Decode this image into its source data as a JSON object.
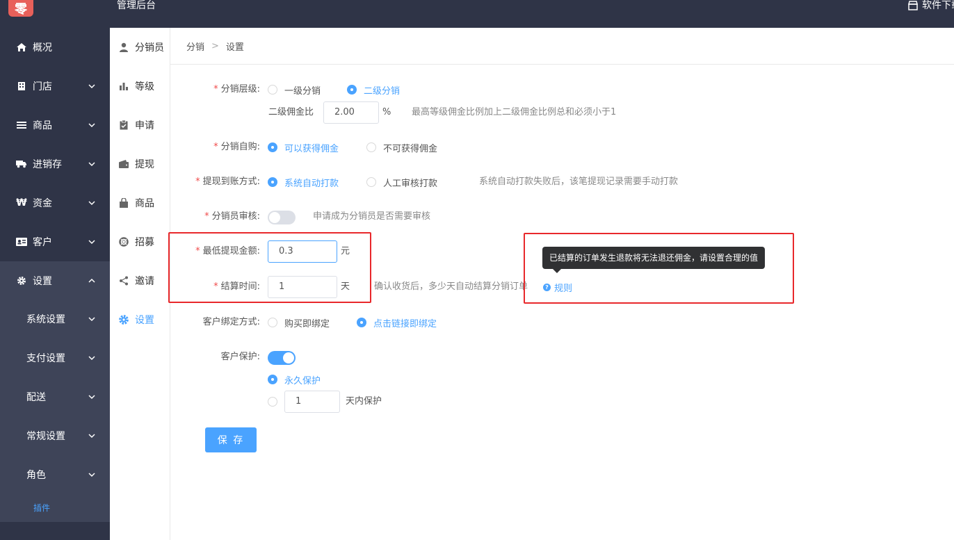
{
  "topbar": {
    "logo_char": "零",
    "title": "管理后台",
    "right_link": "软件下载"
  },
  "sidebar": {
    "items": [
      {
        "label": "概况",
        "icon": "home-icon"
      },
      {
        "label": "门店",
        "icon": "building-icon"
      },
      {
        "label": "商品",
        "icon": "list-icon"
      },
      {
        "label": "进销存",
        "icon": "truck-icon"
      },
      {
        "label": "资金",
        "icon": "won-icon"
      },
      {
        "label": "客户",
        "icon": "id-card-icon"
      },
      {
        "label": "设置",
        "icon": "gear-icon"
      }
    ],
    "sub_items": [
      {
        "label": "系统设置"
      },
      {
        "label": "支付设置"
      },
      {
        "label": "配送"
      },
      {
        "label": "常规设置"
      },
      {
        "label": "角色"
      }
    ],
    "plugin_label": "插件"
  },
  "menu2": {
    "items": [
      {
        "label": "分销员",
        "icon": "user-icon"
      },
      {
        "label": "等级",
        "icon": "bar-chart-icon"
      },
      {
        "label": "申请",
        "icon": "clipboard-check-icon"
      },
      {
        "label": "提现",
        "icon": "wallet-icon"
      },
      {
        "label": "商品",
        "icon": "shopping-bag-icon"
      },
      {
        "label": "招募",
        "icon": "lifebuoy-icon"
      },
      {
        "label": "邀请",
        "icon": "share-icon"
      },
      {
        "label": "设置",
        "icon": "gear-icon"
      }
    ]
  },
  "breadcrumb": {
    "parent": "分销",
    "separator": ">",
    "current": "设置"
  },
  "form": {
    "level": {
      "label": "分销层级:",
      "options": [
        "一级分销",
        "二级分销"
      ],
      "selected": "二级分销",
      "commission_label": "二级佣金比",
      "commission_value": "2.00",
      "commission_unit": "%",
      "commission_hint": "最高等级佣金比例加上二级佣金比例总和必须小于1"
    },
    "self_purchase": {
      "label": "分销自购:",
      "options": [
        "可以获得佣金",
        "不可获得佣金"
      ],
      "selected": "可以获得佣金"
    },
    "withdraw_method": {
      "label": "提现到账方式:",
      "options": [
        "系统自动打款",
        "人工审核打款"
      ],
      "selected": "系统自动打款",
      "hint": "系统自动打款失败后，该笔提现记录需要手动打款"
    },
    "review": {
      "label": "分销员审核:",
      "enabled": false,
      "hint": "申请成为分销员是否需要审核"
    },
    "min_withdraw": {
      "label": "最低提现金额:",
      "value": "0.3",
      "unit": "元"
    },
    "settle_time": {
      "label": "结算时间:",
      "value": "1",
      "unit": "天",
      "hint": "确认收货后，多少天自动结算分销订单",
      "help_link": "规则",
      "tooltip": "已结算的订单发生退款将无法退还佣金，请设置合理的值"
    },
    "bind_method": {
      "label": "客户绑定方式:",
      "options": [
        "购买即绑定",
        "点击链接即绑定"
      ],
      "selected": "点击链接即绑定"
    },
    "protection": {
      "label": "客户保护:",
      "enabled": true,
      "options": [
        "永久保护",
        "天内保护"
      ],
      "selected": "永久保护",
      "days_value": "1"
    },
    "save_label": "保 存"
  },
  "colors": {
    "sidebar_bg": "#2f3447",
    "accent": "#4aa3ff",
    "required_star": "#f04b4b",
    "highlight_box": "#e8282b"
  }
}
